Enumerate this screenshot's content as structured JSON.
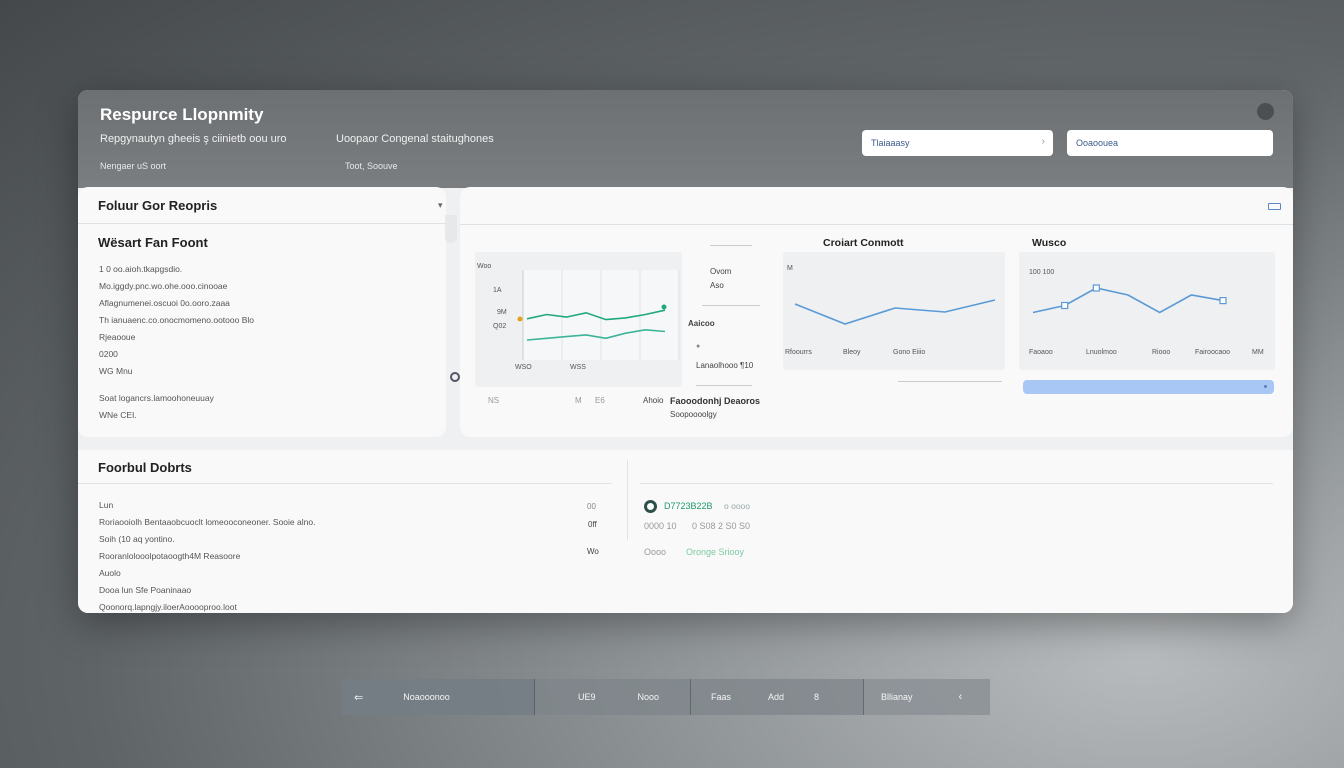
{
  "header": {
    "title": "Respurce Llopnmity",
    "subtitle_left": "Repgynautyn gheeis ş ciinietb oou uro",
    "subtitle_right": "Uoopaor Congenal staitughones",
    "meta_left": "Nengaer uS oort",
    "meta_right": "Toot, Soouve",
    "select_1": "Tlaiaaasy",
    "select_2": "Ooaoouea"
  },
  "left_panel": {
    "heading": "Foluur Gor Reopris",
    "section_title": "Wësart Fan Foont",
    "items": [
      "1 0  oo.aioh.tkapgsdio.",
      "Mo.iggdy.pnc.wo.ohe.ooo.cinooae",
      "Aflagnumenei.oscuoi 0o.ooro.zaaa",
      "Th  ianuaenc.co.onocmomeno.ootooo Blo",
      "Rjeaooue",
      "0200",
      "WG Mnu"
    ],
    "footer": [
      "Soat logancrs.lamoohoneuuay",
      "WNe CEI."
    ]
  },
  "right_panel": {
    "chart_a": {
      "ylabel": "Woo",
      "yticks": [
        "1A",
        "9M",
        "Q02"
      ],
      "xticks": [
        "WSO",
        "WSS"
      ]
    },
    "legend_a": {
      "items": [
        "Ovom",
        "Aso"
      ],
      "label": "Aaicoo"
    },
    "stat_a": "Lanaolhooo ¶10",
    "chart_b": {
      "title": "Croiart Conmott",
      "ylabel": "M",
      "xticks": [
        "Rfoourrs",
        "Bleoy",
        "Gono Eiiio"
      ]
    },
    "chart_c": {
      "title": "Wusco",
      "ylabel": "100 100",
      "xticks": [
        "Faoaoo",
        "Lnuolmoo",
        "Riooo",
        "Fairoocaoo",
        "MM"
      ]
    },
    "caption_left": "Ahoio",
    "caption_bold": "Faooodonhj Deaoros",
    "caption_sub": "Soopoooolgy",
    "axis_bottom": [
      "NS",
      "M",
      "E6"
    ]
  },
  "bottom_panel": {
    "heading": "Foorbul Dobrts",
    "items": [
      "Lun",
      "Roriaooiolh Bentaaobcuoclt lomeooconeoner. Sooie alno.",
      "Soih (10 aq yontino.",
      "Rooranlolooolpotaoogth4M Reasoore",
      "Auolo",
      "Dooa  lun  Sfe Poaninaao",
      "Qoonorq.lapngjy.iloerAooooproo.loot"
    ],
    "values": [
      "00",
      "0ff",
      "Wo"
    ],
    "stats": [
      {
        "text": "D7723B22B",
        "suffix": "o oooo"
      },
      {
        "text": "0000  10",
        "suffix": "0 S08  2 S0 S0"
      },
      {
        "text": "Oooo",
        "suffix": "Oronge Sriooy"
      }
    ]
  },
  "navbar": {
    "back": "⇐",
    "item_1": "Noaooonoo",
    "item_2": "UE9",
    "item_3": "Nooo",
    "item_4": "Faas",
    "item_5": "Add",
    "item_6": "8",
    "item_7": "Bllianay",
    "forward": "‹"
  },
  "chart_data": [
    {
      "type": "line",
      "x": [
        0,
        1,
        2,
        3,
        4,
        5,
        6,
        7
      ],
      "series": [
        {
          "values": [
            0.45,
            0.5,
            0.47,
            0.52,
            0.44,
            0.46,
            0.5,
            0.55
          ]
        },
        {
          "values": [
            0.2,
            0.22,
            0.24,
            0.26,
            0.22,
            0.28,
            0.32,
            0.3
          ]
        }
      ],
      "colors": [
        "#20a880",
        "#3bb49a"
      ]
    },
    {
      "type": "line",
      "title": "Croiart Conmott",
      "x": [
        0,
        1,
        2,
        3,
        4
      ],
      "series": [
        {
          "values": [
            0.6,
            0.35,
            0.55,
            0.5,
            0.65
          ]
        }
      ],
      "colors": [
        "#5a9ad6"
      ]
    },
    {
      "type": "line",
      "title": "Wusco",
      "x": [
        0,
        1,
        2,
        3,
        4,
        5,
        6
      ],
      "series": [
        {
          "values": [
            0.45,
            0.55,
            0.8,
            0.7,
            0.45,
            0.7,
            0.62
          ]
        }
      ],
      "colors": [
        "#5a9ad6"
      ]
    }
  ]
}
